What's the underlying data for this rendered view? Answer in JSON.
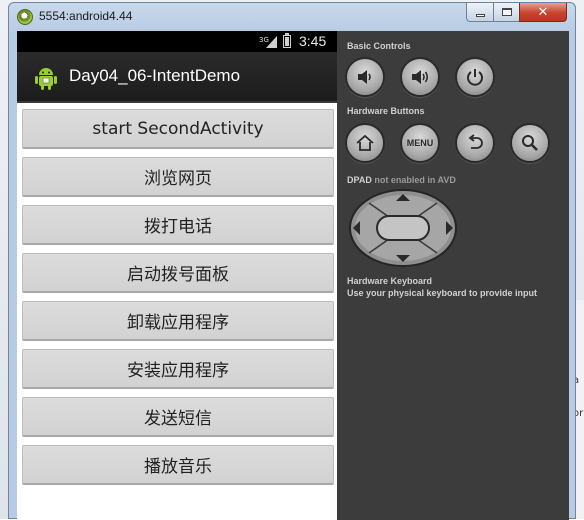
{
  "window": {
    "title": "5554:android4.44",
    "controls": {
      "minimize_icon": "minimize-icon",
      "maximize_icon": "maximize-icon",
      "close_icon": "close-icon",
      "close_glyph": "✕"
    }
  },
  "status_bar": {
    "network_label": "3G",
    "time": "3:45"
  },
  "action_bar": {
    "app_title": "Day04_06-IntentDemo",
    "icon": "android-icon"
  },
  "buttons": [
    {
      "label": "start SecondActivity"
    },
    {
      "label": "浏览网页"
    },
    {
      "label": "拨打电话"
    },
    {
      "label": "启动拨号面板"
    },
    {
      "label": "卸载应用程序"
    },
    {
      "label": "安装应用程序"
    },
    {
      "label": "发送短信"
    },
    {
      "label": "播放音乐"
    }
  ],
  "controls_panel": {
    "basic_controls": {
      "title": "Basic Controls",
      "items": [
        "volume-down-icon",
        "volume-up-icon",
        "power-icon"
      ]
    },
    "hardware_buttons": {
      "title": "Hardware Buttons",
      "menu_label": "MENU",
      "items": [
        "home-icon",
        "menu-button",
        "back-icon",
        "search-icon"
      ]
    },
    "dpad": {
      "title_main": "DPAD",
      "title_note": "not enabled in AVD"
    },
    "keyboard": {
      "title": "Hardware Keyboard",
      "subtitle": "Use your physical keyboard to provide input"
    }
  },
  "background_window": {
    "fragments": [
      "a",
      "or"
    ]
  },
  "colors": {
    "panel_bg": "#3c3c3c",
    "button_bg": "#d6d6d6",
    "status_bar_bg": "#000000",
    "close_button": "#c7432d"
  }
}
